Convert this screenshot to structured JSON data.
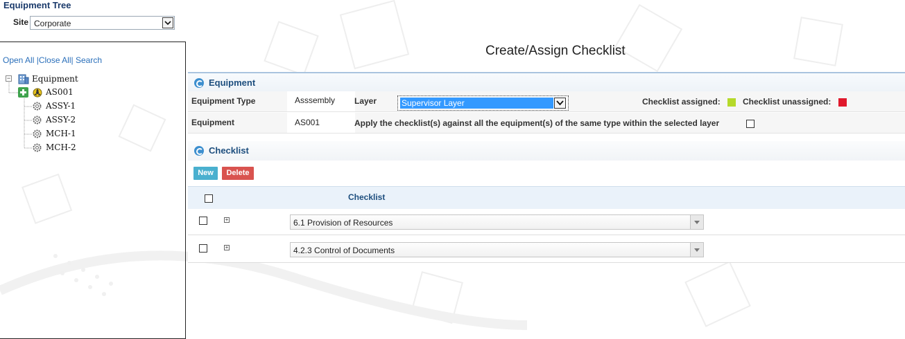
{
  "sidebar": {
    "title": "Equipment Tree",
    "site_label": "Site",
    "site_value": "Corporate",
    "links": {
      "open_all": "Open All",
      "close_all": "Close All",
      "search": "Search"
    },
    "tree": {
      "root": "Equipment",
      "assembly": "AS001",
      "children": [
        "ASSY-1",
        "ASSY-2",
        "MCH-1",
        "MCH-2"
      ]
    }
  },
  "main": {
    "page_title": "Create/Assign Checklist",
    "equipment_section": {
      "title": "Equipment",
      "equipment_type_label": "Equipment Type",
      "equipment_type_value": "Asssembly",
      "layer_label": "Layer",
      "layer_value": "Supervisor Layer",
      "assigned_label": "Checklist assigned:",
      "unassigned_label": "Checklist unassigned:",
      "equipment_label": "Equipment",
      "equipment_value": "AS001",
      "apply_text": "Apply the checklist(s) against all the equipment(s) of the same type within the selected layer"
    },
    "checklist_section": {
      "title": "Checklist",
      "new_label": "New",
      "delete_label": "Delete",
      "column_header": "Checklist",
      "rows": [
        "6.1 Provision of Resources",
        "4.2.3 Control of Documents"
      ]
    }
  },
  "colors": {
    "assigned": "#b5d92a",
    "unassigned": "#e0192c",
    "accent": "#1d4e7e",
    "new_button": "#4ab0cf",
    "delete_button": "#d9534f"
  }
}
